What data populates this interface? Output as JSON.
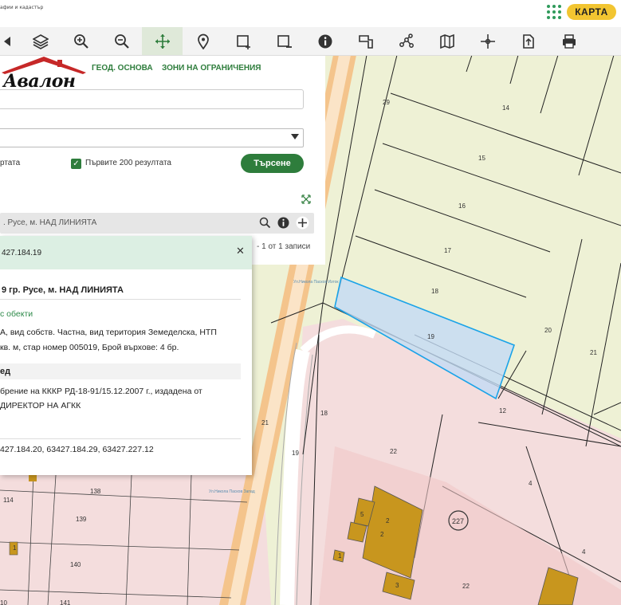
{
  "header": {
    "agency_line1": "афии и кадастър",
    "agency_line2": "",
    "map_button": "КАРТА"
  },
  "toolbar": {
    "tools": [
      "pan-left",
      "layers",
      "zoom-in",
      "zoom-out",
      "move",
      "marker",
      "add-area",
      "remove-area",
      "info",
      "measure",
      "route",
      "map",
      "crosshair",
      "export",
      "print"
    ],
    "active_tool": "move"
  },
  "logo": {
    "text": "Авалон"
  },
  "tabs": {
    "geo_base": "ГЕОД. ОСНОВА",
    "restriction_zones": "ЗОНИ НА ОГРАНИЧЕНИЯ"
  },
  "search_form": {
    "input_value": "",
    "select_value": "",
    "checkbox_left_label": "ртата",
    "checkbox_label": "Първите 200 резултата",
    "search_button": "Търсене"
  },
  "results": {
    "row_text": ". Русе, м. НАД ЛИНИЯТА",
    "pager": "- 1 от 1 записи"
  },
  "popup": {
    "id": "427.184.19",
    "title": "9 гр. Русе, м. НАД ЛИНИЯТА",
    "objects_link": "с обекти",
    "desc_line1": "А, вид собств. Частна, вид територия Земеделска, НТП",
    "desc_line2": "кв. м, стар номер 005019, Брой върхове: 4 бр.",
    "section_label": "ед",
    "order_line1": "брение на КККР РД-18-91/15.12.2007 г., издадена от",
    "order_line2": "ДИРЕКТОР НА АГКК",
    "neighbors": "427.184.20, 63427.184.29, 63427.227.12"
  },
  "map": {
    "parcel_labels": [
      "29",
      "14",
      "15",
      "16",
      "17",
      "18",
      "19",
      "20",
      "21",
      "12",
      "22",
      "4",
      "227",
      "2",
      "5",
      "3",
      "1",
      "22",
      "21",
      "18",
      "19",
      "138",
      "139",
      "140",
      "141",
      "114",
      "1"
    ],
    "street_labels": [
      "Ул.Никола Пасков Изток",
      "Ул.Никола Пасков Запад"
    ]
  },
  "colors": {
    "green": "#2e7d3c",
    "yellow": "#f2c531",
    "farm_fill": "#eef1d5",
    "urban_fill": "#f4dddd",
    "road_fill": "#f4c48c",
    "building": "#c8961e",
    "selected": "#c3dbf5"
  }
}
